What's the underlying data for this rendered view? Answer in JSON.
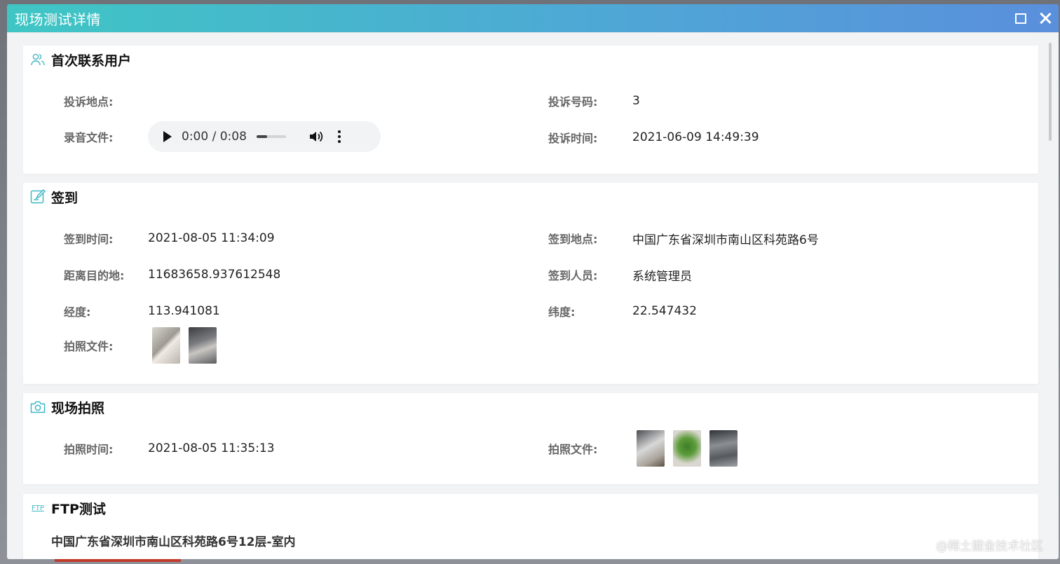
{
  "modal": {
    "title": "现场测试详情"
  },
  "first_contact": {
    "title": "首次联系用户",
    "complaint_location_label": "投诉地点:",
    "complaint_location_value": "",
    "complaint_number_label": "投诉号码:",
    "complaint_number_value": "3",
    "recording_label": "录音文件:",
    "audio_time": "0:00 / 0:08",
    "audio_progress_fraction": 0.35,
    "complaint_time_label": "投诉时间:",
    "complaint_time_value": "2021-06-09 14:49:39"
  },
  "checkin": {
    "title": "签到",
    "time_label": "签到时间:",
    "time_value": "2021-08-05 11:34:09",
    "location_label": "签到地点:",
    "location_value": "中国广东省深圳市南山区科苑路6号",
    "distance_label": "距离目的地:",
    "distance_value": "11683658.937612548",
    "person_label": "签到人员:",
    "person_value": "系统管理员",
    "longitude_label": "经度:",
    "longitude_value": "113.941081",
    "latitude_label": "纬度:",
    "latitude_value": "22.547432",
    "photos_label": "拍照文件:"
  },
  "site_photos": {
    "title": "现场拍照",
    "time_label": "拍照时间:",
    "time_value": "2021-08-05 11:35:13",
    "photos_label": "拍照文件:"
  },
  "ftp": {
    "title": "FTP测试",
    "icon_text": "FTP",
    "address": "中国广东省深圳市南山区科苑路6号12层-室内"
  },
  "watermark": "@稀土掘金技术社区",
  "colors": {
    "header_start": "#3fc6c4",
    "header_end": "#5a8fdc",
    "icon_accent": "#3fb8c4"
  }
}
